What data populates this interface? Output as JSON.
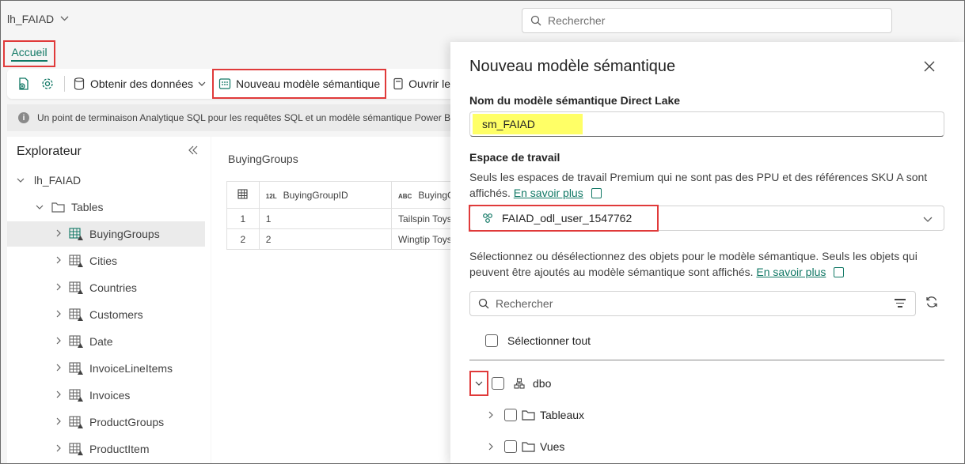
{
  "topbar": {
    "workspace_name": "lh_FAIAD",
    "search_placeholder": "Rechercher"
  },
  "tabs": {
    "home": "Accueil"
  },
  "ribbon": {
    "get_data": "Obtenir des données",
    "new_semantic_model": "Nouveau modèle sémantique",
    "open_in": "Ouvrir le"
  },
  "info_message": "Un point de terminaison Analytique SQL pour les requêtes SQL et un modèle sémantique Power BI",
  "explorer": {
    "title": "Explorateur",
    "root": "lh_FAIAD",
    "tables_folder": "Tables",
    "tables": [
      "BuyingGroups",
      "Cities",
      "Countries",
      "Customers",
      "Date",
      "InvoiceLineItems",
      "Invoices",
      "ProductGroups",
      "ProductItem"
    ]
  },
  "preview": {
    "title": "BuyingGroups",
    "columns": [
      {
        "type": "12L",
        "name": "BuyingGroupID"
      },
      {
        "type": "ABC",
        "name": "BuyingG"
      }
    ],
    "rows": [
      {
        "n": "1",
        "id": "1",
        "name": "Tailspin Toys"
      },
      {
        "n": "2",
        "id": "2",
        "name": "Wingtip Toys"
      }
    ]
  },
  "dialog": {
    "title": "Nouveau modèle sémantique",
    "name_label": "Nom du modèle sémantique Direct Lake",
    "name_value": "sm_FAIAD",
    "workspace_label": "Espace de travail",
    "workspace_note": "Seuls les espaces de travail Premium qui ne sont pas des PPU et des références SKU A sont",
    "workspace_note2": "affichés.",
    "learn_more": "En savoir plus",
    "workspace_value": "FAIAD_odl_user_1547762",
    "objects_note": "Sélectionnez ou désélectionnez des objets pour le modèle sémantique. Seuls les objets qui",
    "objects_note2": "peuvent être ajoutés au modèle sémantique sont affichés.",
    "search_placeholder": "Rechercher",
    "select_all": "Sélectionner tout",
    "schema": "dbo",
    "tables_node": "Tableaux",
    "views_node": "Vues"
  },
  "colors": {
    "accent": "#117865",
    "highlight_border": "#e03a3a",
    "name_highlight": "#ffff66"
  }
}
